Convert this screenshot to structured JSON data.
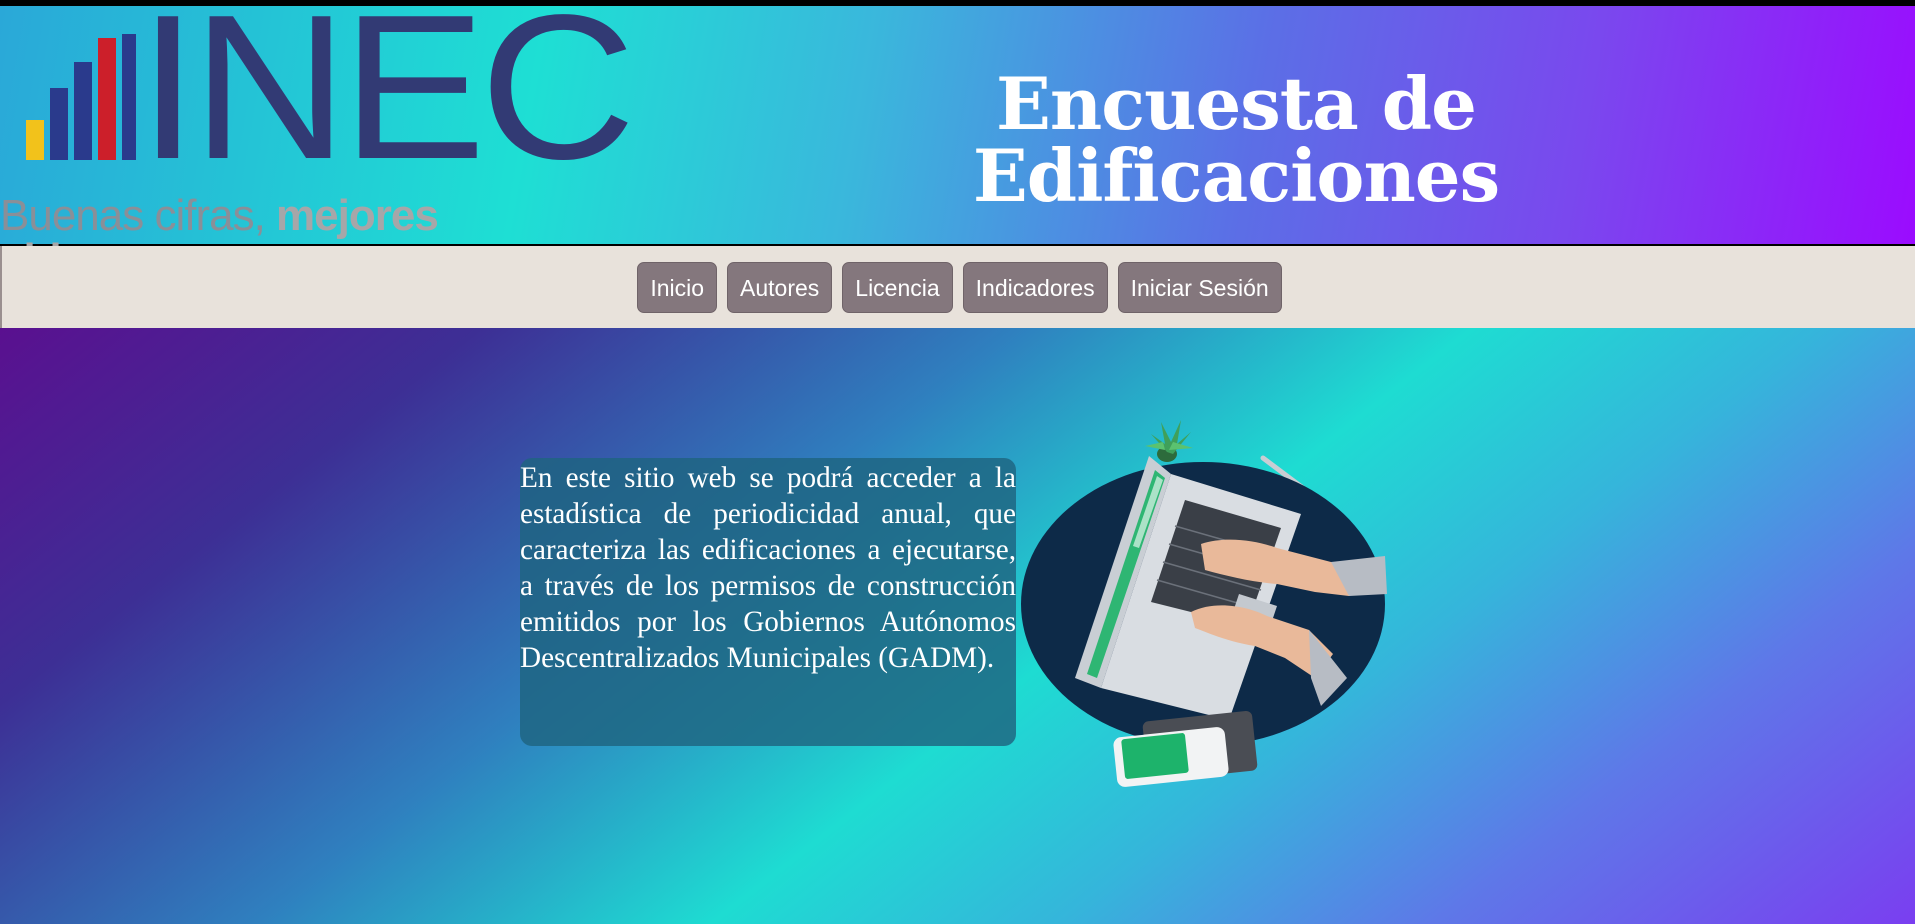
{
  "logo": {
    "brand": "INEC",
    "tagline_light": "Buenas cifras, ",
    "tagline_bold": "mejores vidas",
    "bar_colors": [
      "#f2c21b",
      "#2a3a8c",
      "#cc1f2a",
      "#2a3a8c"
    ]
  },
  "header": {
    "title": "Encuesta de Edificaciones"
  },
  "nav": {
    "items": [
      {
        "label": "Inicio"
      },
      {
        "label": "Autores"
      },
      {
        "label": "Licencia"
      },
      {
        "label": "Indicadores"
      },
      {
        "label": "Iniciar Sesión"
      }
    ]
  },
  "main": {
    "intro": "En este sitio web se podrá acceder a la estadística de periodicidad anual, que caracteriza las edificaciones a ejecutarse, a través de los permisos de construcción emitidos por los Gobiernos Autónomos Descentralizados Municipales (GADM)."
  },
  "colors": {
    "header_gradient": [
      "#1edfd4",
      "#9b0bff"
    ],
    "nav_background": "#e8e2db",
    "nav_button": "#84777d",
    "text_card": "#1e6480"
  },
  "hero_image": {
    "icon": "laptop-typing-illustration"
  }
}
